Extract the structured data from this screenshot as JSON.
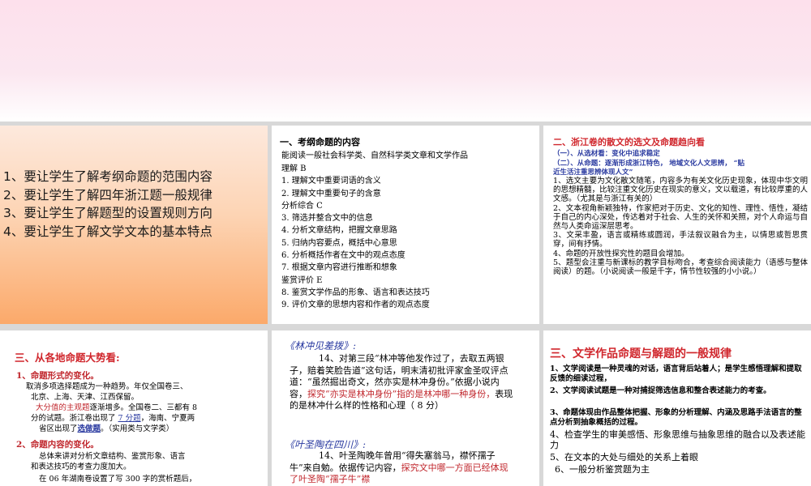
{
  "panel1": {
    "goals": [
      "1、要让学生了解考纲命题的范围内容",
      "2、要让学生了解四年浙江题一般规律",
      "3、要让学生了解题型的设置规则方向",
      "4、要让学生了解文学文本的基本特点"
    ]
  },
  "panel2": {
    "title": "一、考纲命题的内容",
    "intro": "能阅读一般社会科学类、自然科学类文章和文学作品",
    "lines": [
      "理解 B",
      "1. 理解文中重要词语的含义",
      "2. 理解文中重要句子的含意",
      "分析综合 C",
      "3. 筛选并整合文中的信息",
      "4. 分析文章结构，把握文章思路",
      "5. 归纳内容要点，概括中心意思",
      "6. 分析概括作者在文中的观点态度",
      "7. 根据文章内容进行推断和想象",
      "鉴赏评价 E",
      "8.  鉴赏文学作品的形象、语言和表达技巧",
      "9. 评价文章的思想内容和作者的观点态度"
    ]
  },
  "panel3": {
    "title": "二、浙江卷的散文的选文及命题趋向看",
    "sub1": "（一）、从选材看：变化中追求稳定",
    "sub2_line1": "（二）、从命题：逐渐形成浙江特色，  地域文化人文思辨，  “贴",
    "sub2_line2": "近生活注重思辨体现人文”",
    "paras": [
      "1、选文主要为文化散文随笔，内容多为有关文化历史现象，体现中华文明的思想精髓，比较注重文化历史在现实的意义，文以载道，有比较厚重的人文感。（尤其是与浙江有关的）",
      "2、文本视角新颖独特，作家把对于历史、文化的知性、理性、悟性，凝结于自己的内心深处，传达着对于社会、人生的关怀和关照，对个人命运与自然与人类命运深层思考。",
      "3、文采丰盈，语言或精练或圆润，手法叙议融合为主，以情思或哲思贯穿，间有抒情。",
      "4、命题的开放性探究性的题目会增加。",
      "5、题型会注重与新课标的教学目标吻合，考查综合阅读能力（语感与整体阅读）的题。（小说阅读一般是千字，情节性较强的小小说。）"
    ]
  },
  "panel4": {
    "title": "三、从各地命题大势看:",
    "h1": "1、命题形式的变化。",
    "p1_line1": "取消多项选择题成为一种趋势。年仅全国卷三、",
    "p1_line2": "北京、上海、天津、江西保留。",
    "p1_red": "大分值的主观题",
    "p1_line3_rest": "逐渐增多。全国卷二、三都有 8",
    "p1_line4_a": "分的试题。浙江卷出现了 ",
    "p1_line4_b": "7 分题",
    "p1_line4_c": "，海南、宁夏两",
    "p1_line5_a": "省区出现了",
    "p1_line5_b": "选做题",
    "p1_line5_c": "。（实用类与文学类）",
    "h2": "2、命题内容的变化。",
    "p2_line1": "总体来讲对分析文章结构、鉴赏形象、语言",
    "p2_line2": "和表达技巧的考查力度加大。",
    "p3_line1": "在 06 年湖南卷设置了写 300 字的赏析题后，"
  },
  "panel5": {
    "q1_title": "《林冲见差拨》:",
    "q1_a": "14、对第三段“林冲等他发作过了，去取五两银子，赔着笑脸告道”这句话，明末清初批评家金圣叹评点道：“虽然掘出奇文，然亦实是林冲身份。”依据小说内容，",
    "q1_b": "探究“亦实是林冲身份”指的是林冲哪一种身份，",
    "q1_c": "表现的是林冲什么样的性格和心理（ 8 分）",
    "q2_title": "《叶圣陶在四川》:",
    "q2_a": "14、叶圣陶晚年曾用“得失塞翁马，襟怀孺子牛”来自勉。依据传记内容，",
    "q2_b": "探究文中哪一方面已经体现了叶圣陶“孺子牛”襟"
  },
  "panel6": {
    "title": "三、文学作品命题与解题的一般规律",
    "p1": "1、文学阅读是一种灵魂的对话，语言背后站着人；是学生感悟理解和提取反馈的细读过程，",
    "p2": "2、文学阅读试题是一种对捕捉筛选信息和整合表述能力的考查。",
    "p3": "3、命题体现由作品整体把握、形象的分析理解、内涵及思路手法语言的整点分析到抽象概括的过程。",
    "p4": "4、检查学生的审美感悟、形象思维与抽象思维的融合以及表述能力",
    "p5": "5、在文本的大处与细处的关系上着眼",
    "p6": "6、一般分析鉴赏题为主"
  }
}
